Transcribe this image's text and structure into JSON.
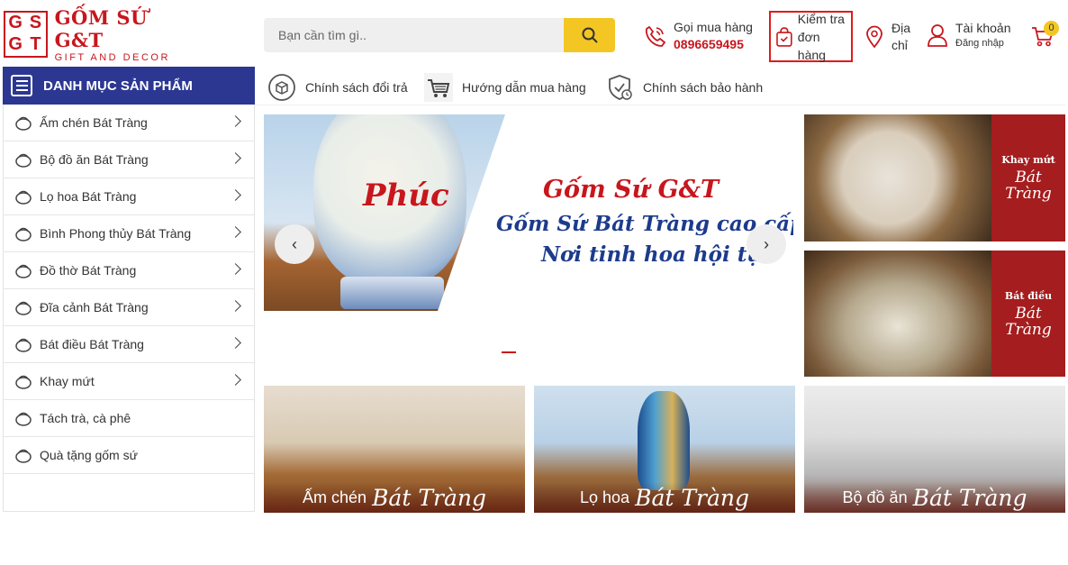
{
  "brand": {
    "mark": [
      "G",
      "S",
      "G",
      "T"
    ],
    "name": "GỐM SỨ G&T",
    "tagline": "GIFT AND DECOR"
  },
  "search": {
    "placeholder": "Bạn cần tìm gì.."
  },
  "header": {
    "hotline_label": "Gọi mua hàng",
    "hotline_number": "0896659495",
    "order_check_line1": "Kiểm tra",
    "order_check_line2": "đơn hàng",
    "address_line1": "Địa",
    "address_line2": "chỉ",
    "account_label": "Tài khoản",
    "account_sub": "Đăng nhập",
    "cart_count": "0"
  },
  "sidebar": {
    "title": "DANH MỤC SẢN PHẨM",
    "items": [
      {
        "label": "Ấm chén Bát Tràng",
        "has_sub": true
      },
      {
        "label": "Bộ đồ ăn Bát Tràng",
        "has_sub": true
      },
      {
        "label": "Lọ hoa Bát Tràng",
        "has_sub": true
      },
      {
        "label": "Bình Phong thủy Bát Tràng",
        "has_sub": true
      },
      {
        "label": "Đồ thờ Bát Tràng",
        "has_sub": true
      },
      {
        "label": "Đĩa cảnh Bát Tràng",
        "has_sub": true
      },
      {
        "label": "Bát điều Bát Tràng",
        "has_sub": true
      },
      {
        "label": "Khay mứt",
        "has_sub": true
      },
      {
        "label": "Tách trà, cà phê",
        "has_sub": false
      },
      {
        "label": "Quà tặng gốm sứ",
        "has_sub": false
      }
    ]
  },
  "policies": [
    {
      "label": "Chính sách đổi trả"
    },
    {
      "label": "Hướng dẫn mua hàng"
    },
    {
      "label": "Chính sách bảo hành"
    }
  ],
  "banner": {
    "vase_text": "Phúc",
    "line1": "Gốm Sứ G&T",
    "line2": "Gốm Sứ  Bát Tràng cao cấp",
    "line3": "Nơi tinh hoa hội tụ",
    "prev": "‹",
    "next": "›"
  },
  "promos": [
    {
      "l1": "Khay mứt",
      "l2": "Bát Tràng"
    },
    {
      "l1": "Bát điều",
      "l2": "Bát Tràng"
    }
  ],
  "tiles": [
    {
      "a": "Ấm chén",
      "b": "Bát Tràng"
    },
    {
      "a": "Lọ hoa",
      "b": "Bát Tràng"
    },
    {
      "a": "Bộ đồ ăn",
      "b": "Bát Tràng"
    }
  ],
  "colors": {
    "brand_red": "#c8161d",
    "nav_blue": "#2b3791",
    "accent_yellow": "#f3c623"
  }
}
